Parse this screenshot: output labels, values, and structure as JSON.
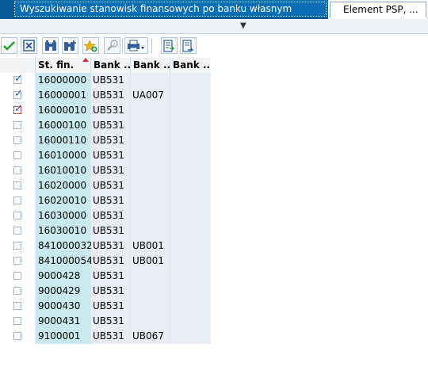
{
  "tabs": {
    "active_title": "Wyszukiwanie stanowisk finansowych po banku własnym",
    "inactive_title": "Element PSP, ..."
  },
  "toolbar": {
    "buttons": [
      {
        "name": "confirm",
        "icon": "check-icon"
      },
      {
        "name": "cancel",
        "icon": "close-box-icon"
      },
      {
        "name": "find",
        "icon": "binoculars-icon"
      },
      {
        "name": "find-next",
        "icon": "binoculars-plus-icon"
      },
      {
        "name": "add-favorite",
        "icon": "star-add-icon"
      },
      {
        "name": "help",
        "icon": "help-icon"
      },
      {
        "name": "print",
        "icon": "printer-icon"
      },
      {
        "name": "export-1",
        "icon": "export-document-icon"
      },
      {
        "name": "export-2",
        "icon": "export-document-arrow-icon"
      }
    ]
  },
  "columns": [
    "St. fin.",
    "Bank ...",
    "Bank ...",
    "Bank ..."
  ],
  "rows": [
    {
      "checked": true,
      "focus": false,
      "fin": "16000000",
      "bank1": "UB531",
      "bank2": "",
      "bank3": ""
    },
    {
      "checked": true,
      "focus": false,
      "fin": "16000001",
      "bank1": "UB531",
      "bank2": "UA007",
      "bank3": ""
    },
    {
      "checked": true,
      "focus": true,
      "fin": "16000010",
      "bank1": "UB531",
      "bank2": "",
      "bank3": ""
    },
    {
      "checked": false,
      "focus": false,
      "fin": "16000100",
      "bank1": "UB531",
      "bank2": "",
      "bank3": ""
    },
    {
      "checked": false,
      "focus": false,
      "fin": "16000110",
      "bank1": "UB531",
      "bank2": "",
      "bank3": ""
    },
    {
      "checked": false,
      "focus": false,
      "fin": "16010000",
      "bank1": "UB531",
      "bank2": "",
      "bank3": ""
    },
    {
      "checked": false,
      "focus": false,
      "fin": "16010010",
      "bank1": "UB531",
      "bank2": "",
      "bank3": ""
    },
    {
      "checked": false,
      "focus": false,
      "fin": "16020000",
      "bank1": "UB531",
      "bank2": "",
      "bank3": ""
    },
    {
      "checked": false,
      "focus": false,
      "fin": "16020010",
      "bank1": "UB531",
      "bank2": "",
      "bank3": ""
    },
    {
      "checked": false,
      "focus": false,
      "fin": "16030000",
      "bank1": "UB531",
      "bank2": "",
      "bank3": ""
    },
    {
      "checked": false,
      "focus": false,
      "fin": "16030010",
      "bank1": "UB531",
      "bank2": "",
      "bank3": ""
    },
    {
      "checked": false,
      "focus": false,
      "fin": "841000032",
      "bank1": "UB531",
      "bank2": "UB001",
      "bank3": ""
    },
    {
      "checked": false,
      "focus": false,
      "fin": "841000054",
      "bank1": "UB531",
      "bank2": "UB001",
      "bank3": ""
    },
    {
      "checked": false,
      "focus": false,
      "fin": "9000428",
      "bank1": "UB531",
      "bank2": "",
      "bank3": ""
    },
    {
      "checked": false,
      "focus": false,
      "fin": "9000429",
      "bank1": "UB531",
      "bank2": "",
      "bank3": ""
    },
    {
      "checked": false,
      "focus": false,
      "fin": "9000430",
      "bank1": "UB531",
      "bank2": "",
      "bank3": ""
    },
    {
      "checked": false,
      "focus": false,
      "fin": "9000431",
      "bank1": "UB531",
      "bank2": "",
      "bank3": ""
    },
    {
      "checked": false,
      "focus": false,
      "fin": "9100001",
      "bank1": "UB531",
      "bank2": "UB067",
      "bank3": ""
    }
  ],
  "colors": {
    "tab_active": "#0a6fb6",
    "key_column": "#c8eaf0",
    "data_column": "#e8eef3",
    "sort_marker": "#d0302a"
  }
}
